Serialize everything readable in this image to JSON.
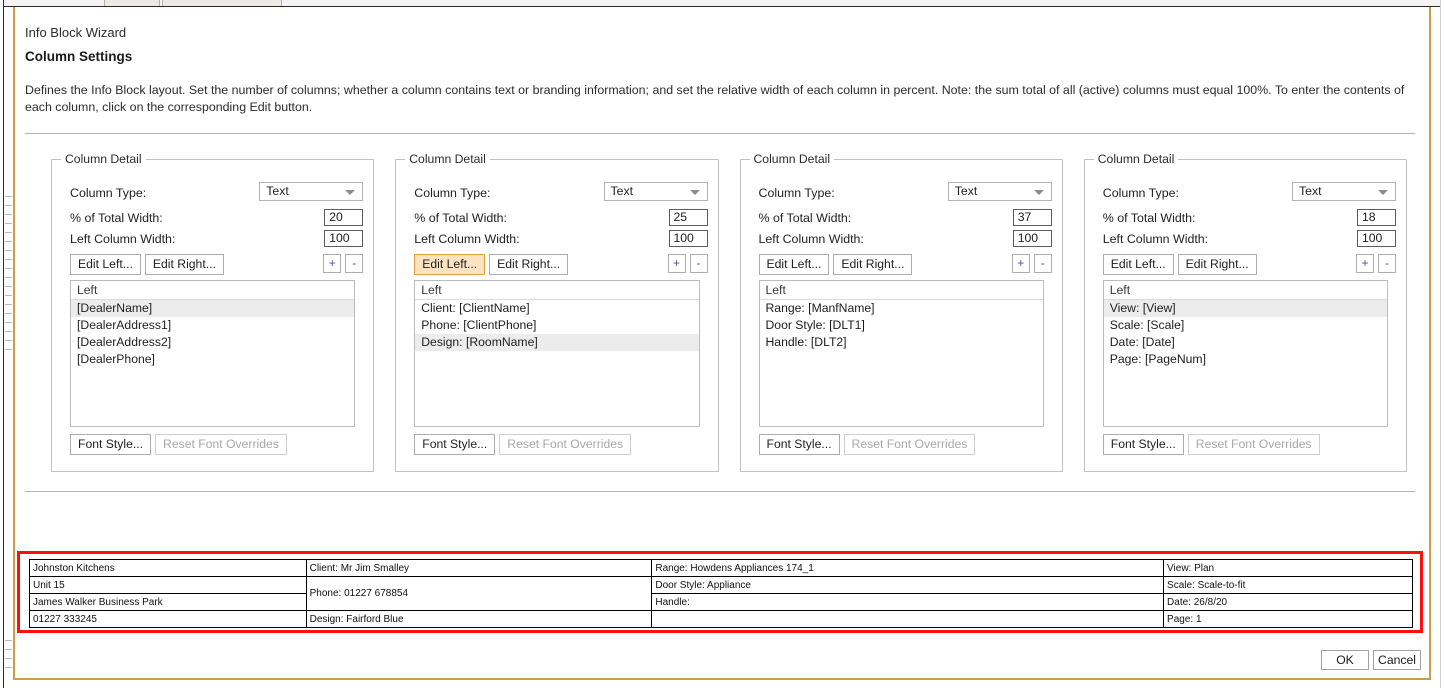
{
  "window": {
    "wizard_name": "Info Block Wizard",
    "page_title": "Column Settings",
    "description": "Defines the Info Block layout. Set the number of columns; whether a column contains text or branding information; and set the relative width of each column in percent. Note: the sum total of all (active) columns must equal 100%. To enter the contents of each column, click on the corresponding Edit button.",
    "border_color": "#cf9a4a",
    "highlight_color": "#fb0f0f"
  },
  "labels": {
    "group_legend": "Column Detail",
    "column_type": "Column Type:",
    "pct_total_width": "% of Total Width:",
    "left_column_width": "Left Column Width:",
    "edit_left": "Edit Left...",
    "edit_right": "Edit Right...",
    "plus": "+",
    "minus": "-",
    "font_style": "Font Style...",
    "reset_font_overrides": "Reset Font Overrides",
    "list_header": "Left"
  },
  "columns": [
    {
      "column_type": "Text",
      "pct_total_width": "20",
      "left_column_width": "100",
      "edit_left_hover": false,
      "items": [
        "[DealerName]",
        "[DealerAddress1]",
        "[DealerAddress2]",
        "[DealerPhone]"
      ],
      "selected_index": 0
    },
    {
      "column_type": "Text",
      "pct_total_width": "25",
      "left_column_width": "100",
      "edit_left_hover": true,
      "items": [
        "Client: [ClientName]",
        "Phone: [ClientPhone]",
        "Design: [RoomName]"
      ],
      "selected_index": 2
    },
    {
      "column_type": "Text",
      "pct_total_width": "37",
      "left_column_width": "100",
      "edit_left_hover": false,
      "items": [
        "Range: [ManfName]",
        "Door Style: [DLT1]",
        "Handle: [DLT2]"
      ],
      "selected_index": -1
    },
    {
      "column_type": "Text",
      "pct_total_width": "18",
      "left_column_width": "100",
      "edit_left_hover": false,
      "items": [
        "View: [View]",
        "Scale: [Scale]",
        "Date: [Date]",
        "Page: [PageNum]"
      ],
      "selected_index": 0
    }
  ],
  "preview": {
    "col1": [
      "Johnston Kitchens",
      "Unit 15",
      "James Walker Business Park",
      "01227 333245"
    ],
    "col2": [
      "Client: Mr Jim Smalley",
      "Phone: 01227 678854",
      "Design: Fairford Blue"
    ],
    "col3": [
      "Range: Howdens Appliances 174_1",
      "Door Style: Appliance",
      "Handle:",
      ""
    ],
    "col4": [
      "View: Plan",
      "Scale: Scale-to-fit",
      "Date: 26/8/20",
      "Page: 1"
    ]
  },
  "footer": {
    "ok": "OK",
    "cancel": "Cancel"
  }
}
